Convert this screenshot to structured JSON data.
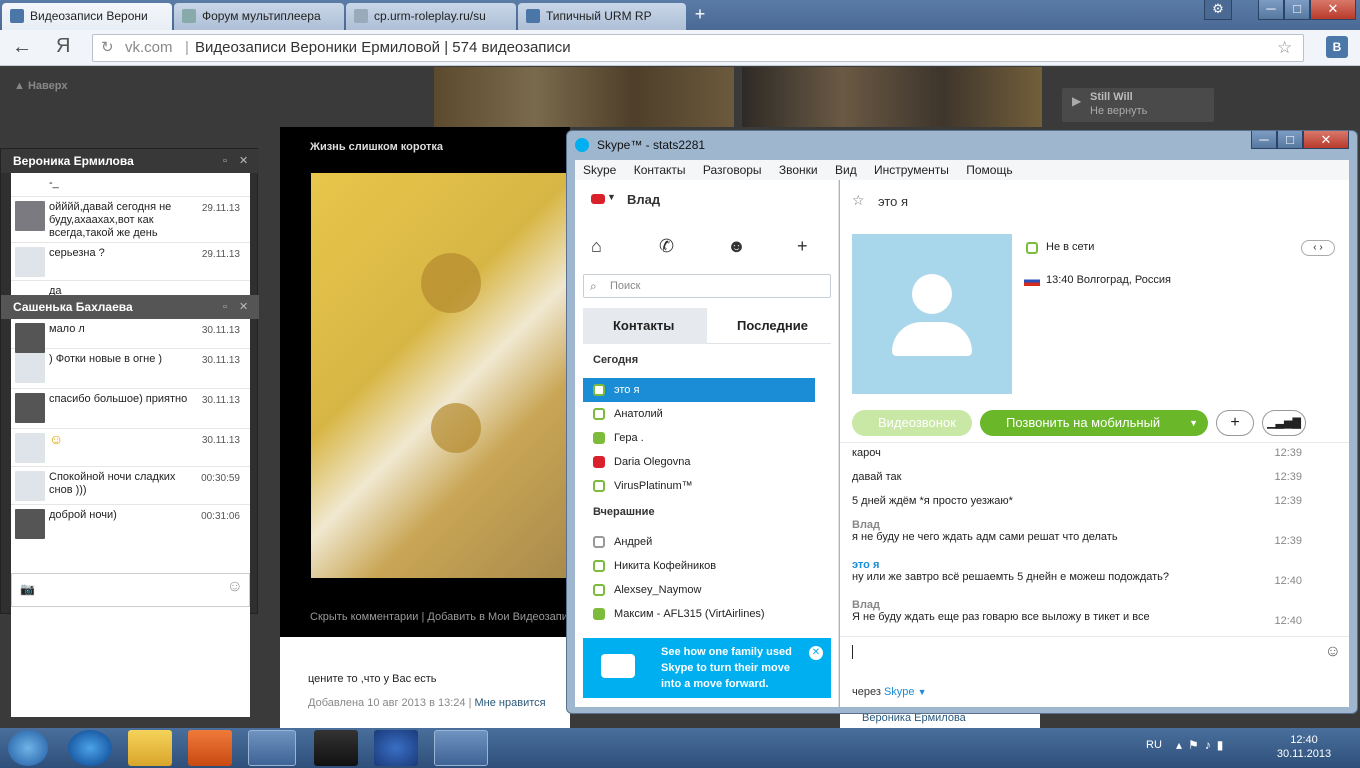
{
  "browser": {
    "tabs": [
      {
        "label": "Видеозаписи Верони",
        "active": true
      },
      {
        "label": "Форум мультиплеера",
        "active": false
      },
      {
        "label": "cp.urm-roleplay.ru/su",
        "active": false
      },
      {
        "label": "Типичный URM RP",
        "active": false
      }
    ],
    "url_host": "vk.com",
    "url_title": "Видеозаписи Вероники Ермиловой | 574 видеозаписи",
    "back_label": "←",
    "yandex_label": "Я",
    "new_tab": "+",
    "settings_icon": "⚙",
    "win_min": "─",
    "win_max": "□",
    "win_close": "✕",
    "vk_badge": "B"
  },
  "vk": {
    "up_link": "▲ Наверх",
    "still_will": "Still Will",
    "still_will_sub": "Не вернуть",
    "video_title": "Жизнь слишком коротка",
    "hide_comments": "Скрыть комментарии",
    "add_to_my": "Добавить в Мои Видеозапи",
    "comment": "цените то ,что у Вас есть",
    "added": "Добавлена 10 авг 2013 в 13:24",
    "like": "Мне нравится",
    "owner": "Вероника Ермилова"
  },
  "chat": {
    "head1": "Вероника Ермилова",
    "head2": "Сашенька Бахлаева",
    "messages": [
      {
        "text": "-_",
        "time": ""
      },
      {
        "text": "ойййй,давай сегодня не буду,ахаахах,вот как всегда,такой же день",
        "time": "29.11.13"
      },
      {
        "text": "серьезна ?",
        "time": "29.11.13"
      },
      {
        "text": "да",
        "time": ""
      },
      {
        "text": "мало л",
        "time": "30.11.13"
      },
      {
        "text": ") Фотки новые в огне )",
        "time": "30.11.13"
      },
      {
        "text": "спасибо большое) приятно",
        "time": "30.11.13"
      },
      {
        "text": "☺",
        "time": "30.11.13"
      },
      {
        "text": "Спокойной ночи сладких снов )))",
        "time": "00:30:59"
      },
      {
        "text": "доброй ночи)",
        "time": "00:31:06"
      }
    ]
  },
  "skype": {
    "title": "Skype™ - stats2281",
    "menu": [
      "Skype",
      "Контакты",
      "Разговоры",
      "Звонки",
      "Вид",
      "Инструменты",
      "Помощь"
    ],
    "user": "Влад",
    "search_placeholder": "Поиск",
    "tab_contacts": "Контакты",
    "tab_recent": "Последние",
    "today": "Сегодня",
    "yesterday": "Вчерашние",
    "contacts_today": [
      "это я",
      "Анатолий",
      "Гера .",
      "Daria Olegovna",
      "VirusPlatinum™"
    ],
    "contacts_yesterday": [
      "Андрей",
      "Никита Кофейников",
      "Alexsey_Naymow",
      "Максим - AFL315 (VirtAirlines)"
    ],
    "ad": "See how one family used Skype to turn their move into a move forward.",
    "contact_name": "это я",
    "status": "Не в сети",
    "location": "13:40 Волгоград, Россия",
    "video_call": "Видеозвонок",
    "call_mobile": "Позвонить на мобильный",
    "messages": [
      {
        "who": "",
        "text": "кароч",
        "time": "12:39"
      },
      {
        "who": "",
        "text": "давай так",
        "time": "12:39"
      },
      {
        "who": "",
        "text": "5 дней ждём *я просто уезжаю*",
        "time": "12:39"
      },
      {
        "who": "Влад",
        "text": "я не буду не чего ждать адм сами решат что делать",
        "time": "12:39"
      },
      {
        "who": "это я",
        "text": "ну или же завтро всё решаемть 5 днейн е можеш подождать?",
        "time": "12:40"
      },
      {
        "who": "Влад",
        "text": "Я не буду ждать еще раз говарю все выложу в тикет и все",
        "time": "12:40"
      }
    ],
    "via": "через",
    "via_skype": "Skype"
  },
  "taskbar": {
    "lang": "RU",
    "time": "12:40",
    "date": "30.11.2013"
  }
}
